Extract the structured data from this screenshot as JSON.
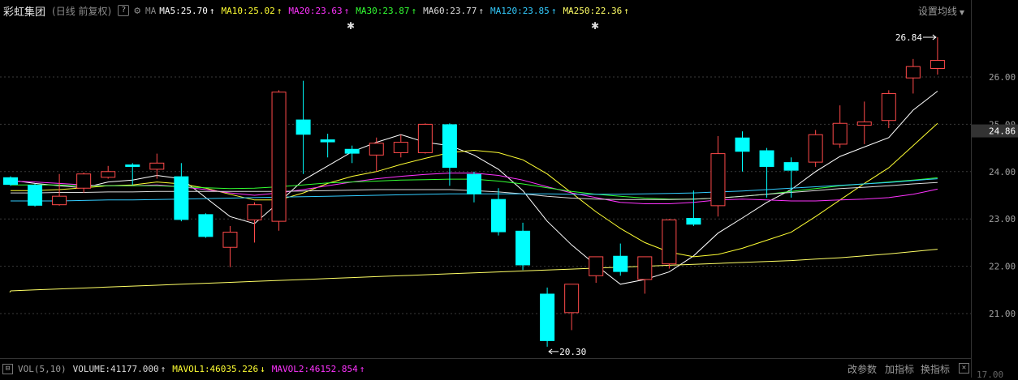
{
  "header": {
    "stock_name": "彩虹集团",
    "period": "(日线 前复权)",
    "help_icon": "?",
    "settings_icon": "gear-icon",
    "ma_label": "MA",
    "ma_items": [
      {
        "label": "MA5:25.70",
        "color": "#ffffff",
        "trend": "↑"
      },
      {
        "label": "MA10:25.02",
        "color": "#ffff33",
        "trend": "↑"
      },
      {
        "label": "MA20:23.63",
        "color": "#ff33ff",
        "trend": "↑"
      },
      {
        "label": "MA30:23.87",
        "color": "#33ff33",
        "trend": "↑"
      },
      {
        "label": "MA60:23.77",
        "color": "#dddddd",
        "trend": "↑"
      },
      {
        "label": "MA120:23.85",
        "color": "#33ccff",
        "trend": "↑"
      },
      {
        "label": "MA250:22.36",
        "color": "#ffff66",
        "trend": "↑"
      }
    ],
    "setting_label": "设置均线"
  },
  "price_axis": {
    "ticks": [
      "26.00",
      "25.00",
      "24.00",
      "23.00",
      "22.00",
      "21.00"
    ],
    "current_price_label": "24.86"
  },
  "annotations": {
    "high_label": "26.84",
    "low_label": "20.30",
    "star": "✱"
  },
  "footer": {
    "indicator_name": "VOL(5,10)",
    "volume": "VOLUME:41177.000",
    "volume_trend": "↑",
    "mavol1": "MAVOL1:46035.226",
    "mavol1_trend": "↓",
    "mavol2": "MAVOL2:46152.854",
    "mavol2_trend": "↑",
    "buttons": [
      "改参数",
      "加指标",
      "换指标"
    ],
    "close_label": "✕",
    "axis_bottom_label": "17.00"
  },
  "colors": {
    "up": "#ff4a4a",
    "down": "#00ffff",
    "background": "#000000"
  },
  "chart_data": {
    "type": "candlestick",
    "ylim": [
      20.0,
      27.0
    ],
    "candles": [
      {
        "o": 23.88,
        "c": 23.72,
        "h": 23.9,
        "l": 23.7
      },
      {
        "o": 23.72,
        "c": 23.28,
        "h": 23.74,
        "l": 23.26
      },
      {
        "o": 23.3,
        "c": 23.48,
        "h": 23.95,
        "l": 23.28
      },
      {
        "o": 23.65,
        "c": 23.95,
        "h": 23.98,
        "l": 23.55
      },
      {
        "o": 23.88,
        "c": 24.0,
        "h": 24.12,
        "l": 23.85
      },
      {
        "o": 24.15,
        "c": 24.1,
        "h": 24.18,
        "l": 23.72
      },
      {
        "o": 24.05,
        "c": 24.18,
        "h": 24.38,
        "l": 23.85
      },
      {
        "o": 23.9,
        "c": 22.98,
        "h": 24.18,
        "l": 22.95
      },
      {
        "o": 23.1,
        "c": 22.62,
        "h": 23.12,
        "l": 22.6
      },
      {
        "o": 22.4,
        "c": 22.72,
        "h": 22.85,
        "l": 21.98
      },
      {
        "o": 22.98,
        "c": 23.3,
        "h": 23.35,
        "l": 22.5
      },
      {
        "o": 22.95,
        "c": 25.68,
        "h": 25.72,
        "l": 22.75
      },
      {
        "o": 25.1,
        "c": 24.78,
        "h": 25.92,
        "l": 23.95
      },
      {
        "o": 24.68,
        "c": 24.62,
        "h": 24.8,
        "l": 24.3
      },
      {
        "o": 24.48,
        "c": 24.38,
        "h": 24.55,
        "l": 24.18
      },
      {
        "o": 24.35,
        "c": 24.6,
        "h": 24.72,
        "l": 24.0
      },
      {
        "o": 24.4,
        "c": 24.62,
        "h": 24.78,
        "l": 24.3
      },
      {
        "o": 24.4,
        "c": 25.0,
        "h": 25.02,
        "l": 24.38
      },
      {
        "o": 25.0,
        "c": 24.08,
        "h": 25.02,
        "l": 23.7
      },
      {
        "o": 23.95,
        "c": 23.52,
        "h": 24.0,
        "l": 23.35
      },
      {
        "o": 23.42,
        "c": 22.72,
        "h": 23.65,
        "l": 22.65
      },
      {
        "o": 22.75,
        "c": 22.02,
        "h": 22.92,
        "l": 21.92
      },
      {
        "o": 21.42,
        "c": 20.42,
        "h": 21.55,
        "l": 20.3
      },
      {
        "o": 21.02,
        "c": 21.62,
        "h": 21.62,
        "l": 20.65
      },
      {
        "o": 21.8,
        "c": 22.2,
        "h": 22.2,
        "l": 21.65
      },
      {
        "o": 22.22,
        "c": 21.88,
        "h": 22.48,
        "l": 21.8
      },
      {
        "o": 21.72,
        "c": 22.2,
        "h": 22.2,
        "l": 21.42
      },
      {
        "o": 22.05,
        "c": 22.98,
        "h": 23.0,
        "l": 21.95
      },
      {
        "o": 23.02,
        "c": 22.88,
        "h": 23.6,
        "l": 22.85
      },
      {
        "o": 23.28,
        "c": 24.38,
        "h": 24.75,
        "l": 23.05
      },
      {
        "o": 24.72,
        "c": 24.42,
        "h": 24.85,
        "l": 24.0
      },
      {
        "o": 24.45,
        "c": 24.1,
        "h": 24.5,
        "l": 23.45
      },
      {
        "o": 24.2,
        "c": 24.02,
        "h": 24.3,
        "l": 23.45
      },
      {
        "o": 24.2,
        "c": 24.78,
        "h": 24.88,
        "l": 24.1
      },
      {
        "o": 24.58,
        "c": 25.02,
        "h": 25.4,
        "l": 24.5
      },
      {
        "o": 24.98,
        "c": 25.05,
        "h": 25.48,
        "l": 24.58
      },
      {
        "o": 25.08,
        "c": 25.65,
        "h": 25.72,
        "l": 24.92
      },
      {
        "o": 25.98,
        "c": 26.22,
        "h": 26.38,
        "l": 25.65
      },
      {
        "o": 26.18,
        "c": 26.35,
        "h": 26.84,
        "l": 26.05
      }
    ],
    "ma_lines": [
      {
        "name": "MA5",
        "color": "#ffffff",
        "values": [
          23.82,
          23.75,
          23.7,
          23.66,
          23.78,
          23.82,
          23.92,
          23.85,
          23.45,
          23.05,
          22.9,
          23.35,
          23.82,
          24.12,
          24.42,
          24.62,
          24.78,
          24.62,
          24.55,
          24.35,
          24.05,
          23.6,
          22.95,
          22.45,
          22.02,
          21.62,
          21.72,
          21.88,
          22.22,
          22.7,
          23.02,
          23.35,
          23.62,
          24.0,
          24.32,
          24.52,
          24.72,
          25.3,
          25.7
        ]
      },
      {
        "name": "MA10",
        "color": "#ffff33",
        "values": [
          23.6,
          23.6,
          23.62,
          23.66,
          23.7,
          23.72,
          23.78,
          23.74,
          23.65,
          23.52,
          23.4,
          23.4,
          23.55,
          23.75,
          23.9,
          24.0,
          24.15,
          24.28,
          24.4,
          24.45,
          24.4,
          24.25,
          23.95,
          23.55,
          23.15,
          22.8,
          22.5,
          22.3,
          22.2,
          22.25,
          22.38,
          22.55,
          22.72,
          23.05,
          23.4,
          23.75,
          24.08,
          24.55,
          25.02
        ]
      },
      {
        "name": "MA20",
        "color": "#ff33ff",
        "values": [
          23.8,
          23.78,
          23.75,
          23.72,
          23.7,
          23.7,
          23.72,
          23.68,
          23.62,
          23.55,
          23.5,
          23.55,
          23.62,
          23.7,
          23.78,
          23.85,
          23.9,
          23.94,
          23.97,
          23.97,
          23.92,
          23.82,
          23.68,
          23.55,
          23.45,
          23.35,
          23.32,
          23.32,
          23.35,
          23.4,
          23.42,
          23.4,
          23.38,
          23.38,
          23.4,
          23.42,
          23.45,
          23.52,
          23.63
        ]
      },
      {
        "name": "MA30",
        "color": "#33ff33",
        "values": [
          23.72,
          23.72,
          23.72,
          23.7,
          23.7,
          23.7,
          23.7,
          23.68,
          23.66,
          23.64,
          23.65,
          23.68,
          23.72,
          23.76,
          23.78,
          23.8,
          23.82,
          23.83,
          23.84,
          23.84,
          23.8,
          23.74,
          23.66,
          23.58,
          23.52,
          23.48,
          23.44,
          23.42,
          23.42,
          23.44,
          23.48,
          23.52,
          23.58,
          23.64,
          23.7,
          23.74,
          23.78,
          23.82,
          23.87
        ]
      },
      {
        "name": "MA60",
        "color": "#dddddd",
        "values": [
          23.55,
          23.55,
          23.56,
          23.56,
          23.57,
          23.57,
          23.58,
          23.58,
          23.58,
          23.58,
          23.58,
          23.58,
          23.59,
          23.6,
          23.61,
          23.62,
          23.62,
          23.62,
          23.62,
          23.6,
          23.57,
          23.53,
          23.48,
          23.44,
          23.42,
          23.41,
          23.41,
          23.41,
          23.42,
          23.44,
          23.48,
          23.52,
          23.56,
          23.6,
          23.64,
          23.67,
          23.7,
          23.74,
          23.77
        ]
      },
      {
        "name": "MA120",
        "color": "#33ccff",
        "values": [
          23.38,
          23.38,
          23.38,
          23.39,
          23.4,
          23.4,
          23.41,
          23.42,
          23.43,
          23.44,
          23.45,
          23.46,
          23.47,
          23.48,
          23.49,
          23.5,
          23.51,
          23.52,
          23.53,
          23.53,
          23.53,
          23.53,
          23.53,
          23.52,
          23.52,
          23.52,
          23.53,
          23.54,
          23.55,
          23.57,
          23.59,
          23.62,
          23.65,
          23.68,
          23.71,
          23.74,
          23.77,
          23.81,
          23.85
        ]
      },
      {
        "name": "MA250",
        "color": "#ffff66",
        "values": [
          21.48,
          21.5,
          21.52,
          21.54,
          21.56,
          21.58,
          21.6,
          21.62,
          21.64,
          21.66,
          21.68,
          21.7,
          21.72,
          21.74,
          21.76,
          21.78,
          21.8,
          21.82,
          21.84,
          21.86,
          21.88,
          21.9,
          21.92,
          21.94,
          21.96,
          21.98,
          22.0,
          22.02,
          22.04,
          22.06,
          22.08,
          22.1,
          22.12,
          22.15,
          22.18,
          22.22,
          22.26,
          22.31,
          22.36
        ]
      }
    ]
  }
}
